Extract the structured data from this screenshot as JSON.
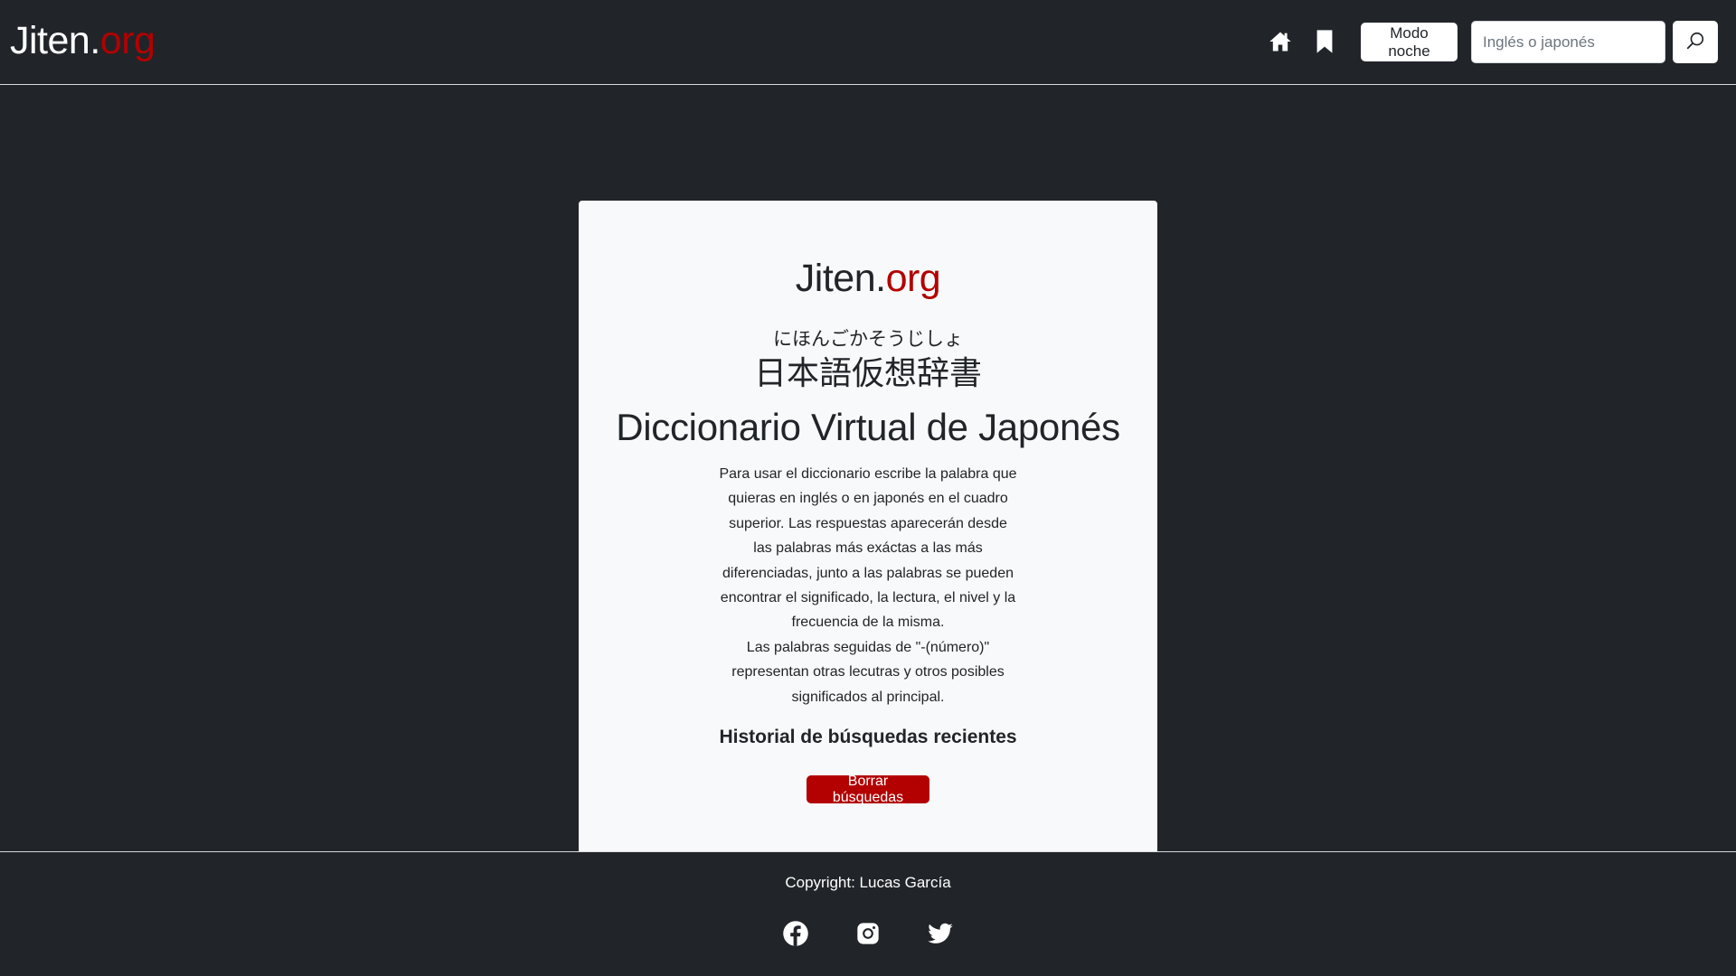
{
  "header": {
    "brand_main": "Jiten.",
    "brand_accent": "org",
    "icons": [
      "home-icon",
      "bookmark-icon"
    ],
    "night_mode_label": "Modo noche",
    "search_placeholder": "Inglés o japonés",
    "search_icon": "search-icon"
  },
  "main": {
    "title_main": "Jiten.",
    "title_accent": "org",
    "furigana": "にほんごかそうじしょ",
    "kanji_title": "日本語仮想辞書",
    "subtitle": "Diccionario Virtual de Japonés",
    "description_1": "Para usar el diccionario escribe la palabra que quieras en inglés o en japonés en el cuadro superior. Las respuestas aparecerán desde las palabras más exáctas a las más diferenciadas, junto a las palabras se pueden encontrar el significado, la lectura, el nivel y la frecuencia de la misma.",
    "description_2": "Las palabras seguidas de \"-(número)\" representan otras lecutras y otros posibles significados al principal.",
    "history_heading": "Historial de búsquedas recientes",
    "clear_button_label": "Borrar búsquedas"
  },
  "footer": {
    "copyright": "Copyright: Lucas García",
    "social_icons": [
      "facebook-icon",
      "instagram-icon",
      "twitter-icon"
    ]
  },
  "colors": {
    "background": "#212529",
    "card": "#f8f9fa",
    "accent": "#b30000",
    "text_light": "#ffffff",
    "text_dark": "#212529"
  }
}
